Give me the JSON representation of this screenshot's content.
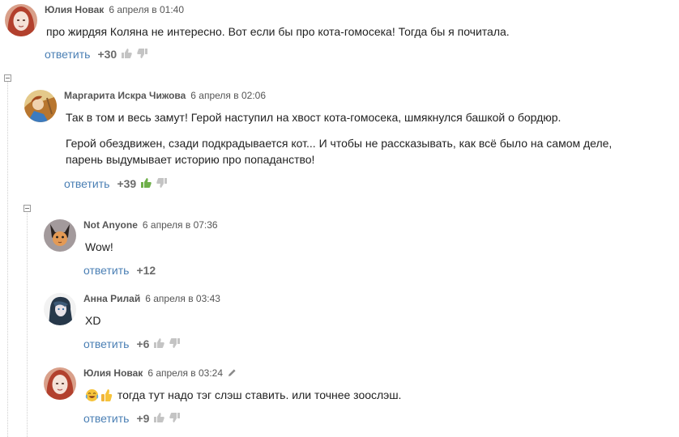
{
  "comments": [
    {
      "author": "Юлия Новак",
      "date": "6 апреля в 01:40",
      "paragraphs": [
        "про жирдяя Коляна не интересно. Вот если бы про кота-гомосека! Тогда бы я почитала."
      ],
      "reply_label": "ответить",
      "score": "+30"
    },
    {
      "author": "Маргарита Искра Чижова",
      "date": "6 апреля в 02:06",
      "paragraphs": [
        "Так в том и весь замут! Герой наступил на хвост кота-гомосека, шмякнулся башкой о бордюр.",
        "Герой обездвижен, сзади подкрадывается кот... И чтобы не рассказывать, как всё было на самом деле, парень выдумывает историю про попаданство!"
      ],
      "reply_label": "ответить",
      "score": "+39",
      "upvoted": true
    },
    {
      "author": "Not Anyone",
      "date": "6 апреля в 07:36",
      "paragraphs": [
        "Wow!"
      ],
      "reply_label": "ответить",
      "score": "+12"
    },
    {
      "author": "Анна Рилай",
      "date": "6 апреля в 03:43",
      "paragraphs": [
        "XD"
      ],
      "reply_label": "ответить",
      "score": "+6"
    },
    {
      "author": "Юлия Новак",
      "date": "6 апреля в 03:24",
      "edited": true,
      "paragraphs": [
        "тогда тут надо тэг слэш ставить. или точнее зоослэш."
      ],
      "emojis": [
        "tears-of-joy-emoji",
        "thumbs-up-emoji"
      ],
      "reply_label": "ответить",
      "score": "+9"
    }
  ],
  "colors": {
    "link": "#4a7fb4",
    "score": "#6b6b6b",
    "vote_inactive": "#c4c4c4",
    "vote_up_active": "#6fb04a",
    "thread_line": "#cfcfcf"
  },
  "icons": {
    "vote_up": "thumbs-up-icon",
    "vote_down": "thumbs-down-icon",
    "collapse": "collapse-minus-icon",
    "edited": "pencil-icon"
  }
}
